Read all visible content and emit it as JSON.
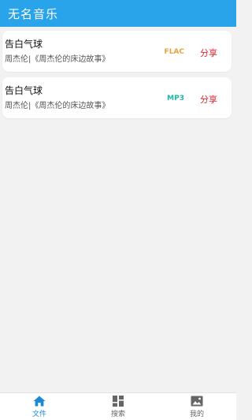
{
  "appbar": {
    "title": "无名音乐"
  },
  "songs": [
    {
      "title": "告白气球",
      "meta": "周杰伦|《周杰伦的床边故事》",
      "format": "FLAC",
      "format_color": "#e8a33d",
      "share": "分享"
    },
    {
      "title": "告白气球",
      "meta": "周杰伦|《周杰伦的床边故事》",
      "format": "MP3",
      "format_color": "#21b5a8",
      "share": "分享"
    }
  ],
  "bottom_nav": {
    "active_color": "#1a8ad4",
    "inactive_color": "#666666",
    "tabs": [
      {
        "label": "文件",
        "icon": "home-icon",
        "active": true
      },
      {
        "label": "搜索",
        "icon": "dashboard-icon",
        "active": false
      },
      {
        "label": "我的",
        "icon": "image-icon",
        "active": false
      }
    ]
  }
}
